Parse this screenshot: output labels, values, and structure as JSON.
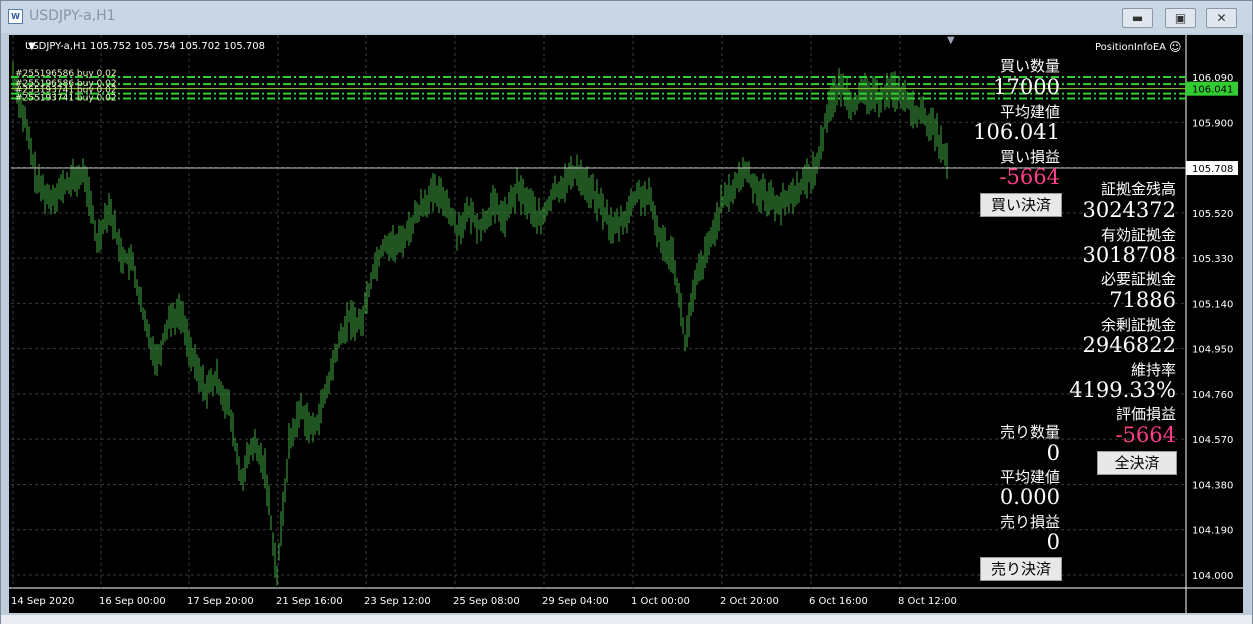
{
  "window": {
    "title": "USDJPY-a,H1",
    "minimize": "▬",
    "maximize": "▣",
    "close": "✕"
  },
  "chart": {
    "header": "USDJPY-a,H1  105.752 105.754 105.702 105.708",
    "ea_name": "PositionInfoEA",
    "current_price": "105.708",
    "avg_price_tag": "106.041",
    "order_labels": [
      "#255196586 buy 0.02",
      "#255196586 buy 0.02",
      "#255193741 buy 0.02",
      "#255193741 buy 0.02"
    ],
    "colors": {
      "up": "#39ff14",
      "bars": "#3fa83f",
      "grid": "#3a3a3a",
      "loss": "#ff3d8b",
      "avg_line": "#32cd32"
    }
  },
  "chart_data": {
    "type": "line",
    "symbol": "USDJPY-a",
    "timeframe": "H1",
    "ylim": [
      104.0,
      106.14
    ],
    "y_ticks": [
      "106.090",
      "105.900",
      "105.710",
      "105.520",
      "105.330",
      "105.140",
      "104.950",
      "104.760",
      "104.570",
      "104.380",
      "104.190",
      "104.000"
    ],
    "x_ticks": [
      "14 Sep 2020",
      "16 Sep 00:00",
      "17 Sep 20:00",
      "21 Sep 16:00",
      "23 Sep 12:00",
      "25 Sep 08:00",
      "29 Sep 04:00",
      "1 Oct 00:00",
      "2 Oct 20:00",
      "6 Oct 16:00",
      "8 Oct 12:00"
    ],
    "series": [
      {
        "values": [
          106.1,
          105.9,
          105.65,
          105.58,
          105.62,
          105.66,
          105.68,
          105.4,
          105.55,
          105.35,
          105.3,
          105.05,
          104.9,
          105.08,
          105.1,
          104.9,
          104.78,
          104.82,
          104.7,
          104.4,
          104.55,
          104.45,
          104.0,
          104.55,
          104.7,
          104.6,
          104.75,
          104.95,
          105.08,
          105.05,
          105.28,
          105.4,
          105.38,
          105.45,
          105.55,
          105.6,
          105.58,
          105.45,
          105.52,
          105.46,
          105.55,
          105.5,
          105.62,
          105.56,
          105.48,
          105.6,
          105.65,
          105.7,
          105.62,
          105.55,
          105.45,
          105.5,
          105.6,
          105.58,
          105.4,
          105.35,
          104.98,
          105.25,
          105.38,
          105.55,
          105.62,
          105.7,
          105.62,
          105.58,
          105.55,
          105.6,
          105.65,
          105.72,
          105.98,
          106.05,
          105.98,
          106.02,
          106.0,
          106.04,
          106.02,
          105.95,
          105.92,
          105.85,
          105.708
        ]
      }
    ],
    "grid": true
  },
  "panel": {
    "buy_qty_label": "買い数量",
    "buy_qty": "17000",
    "buy_avg_label": "平均建値",
    "buy_avg": "106.041",
    "buy_pl_label": "買い損益",
    "buy_pl": "-5664",
    "buy_close_button": "買い決済",
    "balance_label": "証拠金残高",
    "balance": "3024372",
    "equity_label": "有効証拠金",
    "equity": "3018708",
    "margin_label": "必要証拠金",
    "margin": "71886",
    "free_margin_label": "余剰証拠金",
    "free_margin": "2946822",
    "level_label": "維持率",
    "level": "4199.33%",
    "unrealized_label": "評価損益",
    "unrealized": "-5664",
    "close_all_button": "全決済",
    "sell_qty_label": "売り数量",
    "sell_qty": "0",
    "sell_avg_label": "平均建値",
    "sell_avg": "0.000",
    "sell_pl_label": "売り損益",
    "sell_pl": "0",
    "sell_close_button": "売り決済"
  }
}
